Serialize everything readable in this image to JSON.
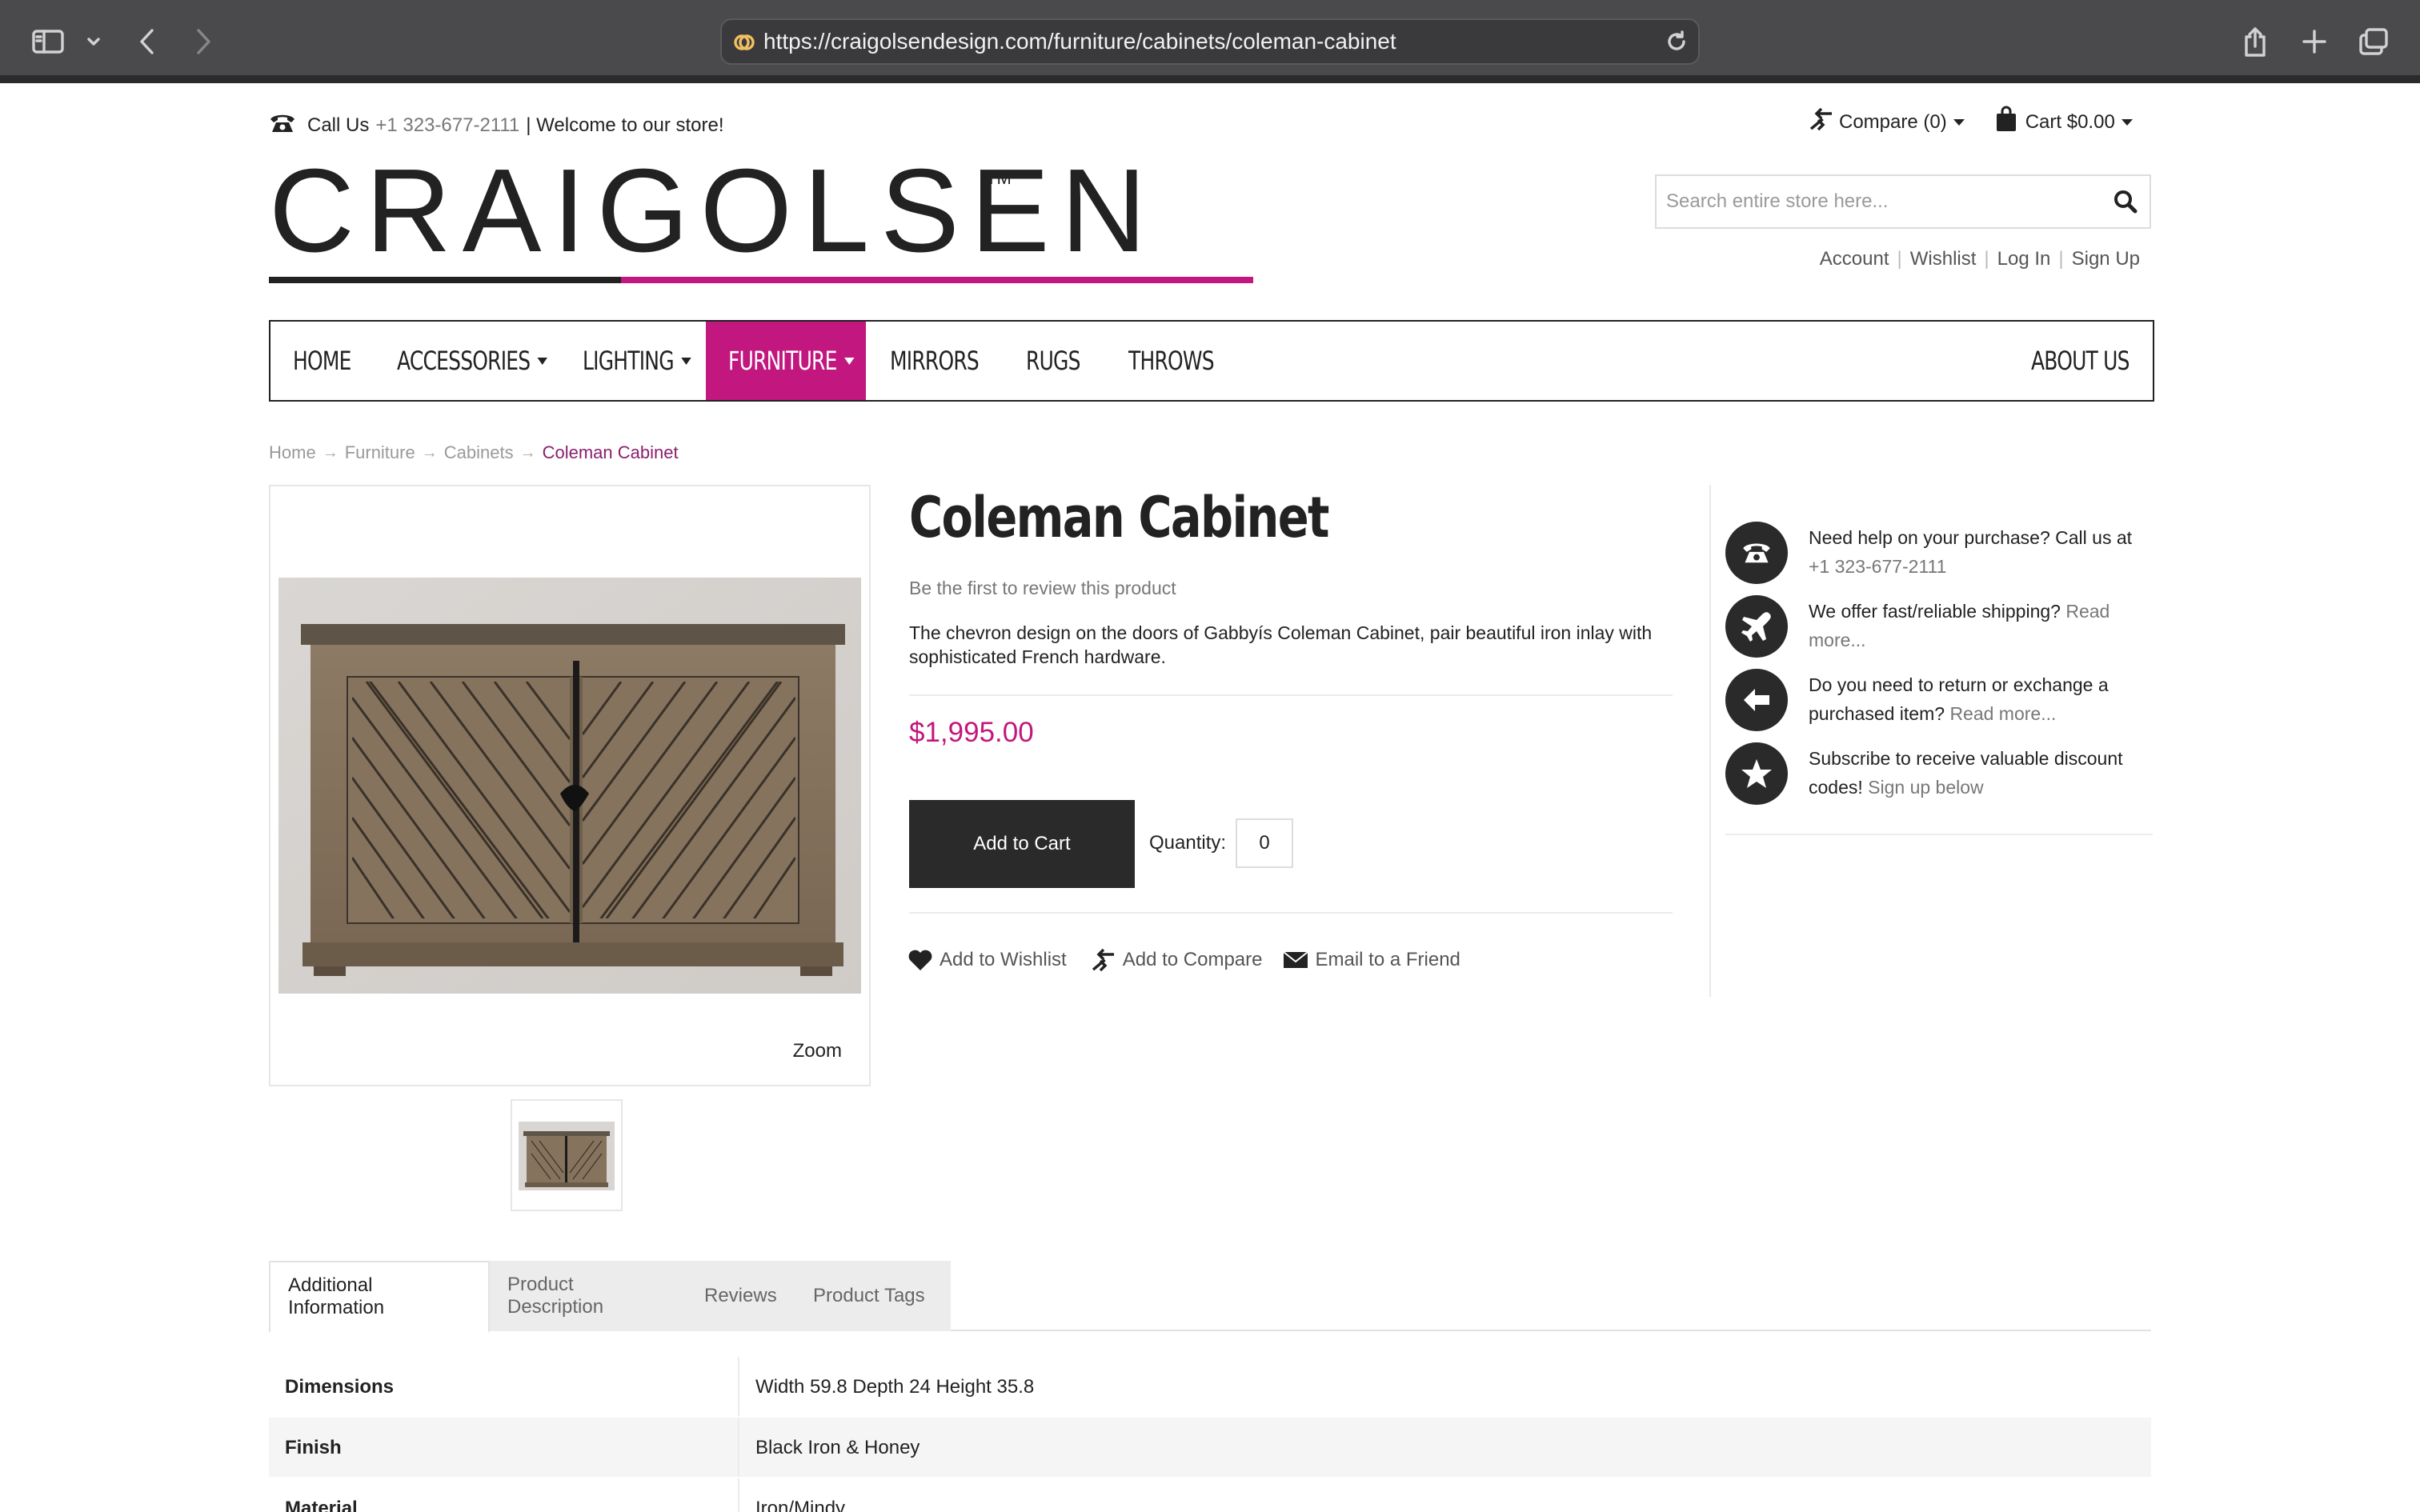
{
  "browser": {
    "url": "https://craigolsendesign.com/furniture/cabinets/coleman-cabinet"
  },
  "topbar": {
    "call_label": "Call Us",
    "phone": "+1 323-677-2111",
    "welcome": "| Welcome to our store!",
    "compare": "Compare (0)",
    "cart": "Cart $0.00"
  },
  "logo": {
    "text": "CRAIGOLSEN",
    "tm": "TM",
    "accent_color": "#c2177e"
  },
  "search": {
    "placeholder": "Search entire store here..."
  },
  "account_links": [
    "Account",
    "Wishlist",
    "Log In",
    "Sign Up"
  ],
  "nav": {
    "items": [
      "HOME",
      "ACCESSORIES",
      "LIGHTING",
      "FURNITURE",
      "MIRRORS",
      "RUGS",
      "THROWS",
      "ABOUT US"
    ],
    "active": "FURNITURE"
  },
  "breadcrumb": [
    "Home",
    "Furniture",
    "Cabinets",
    "Coleman Cabinet"
  ],
  "product": {
    "title": "Coleman Cabinet",
    "review_prompt": "Be the first to review this product",
    "description": "The chevron design on the doors of Gabbyís Coleman Cabinet, pair beautiful iron inlay with sophisticated French hardware.",
    "price": "$1,995.00",
    "add_to_cart": "Add to Cart",
    "quantity_label": "Quantity:",
    "quantity_value": "0",
    "zoom_label": "Zoom",
    "actions": [
      "Add to Wishlist",
      "Add to Compare",
      "Email to a Friend"
    ]
  },
  "help": [
    {
      "icon": "phone-icon",
      "text": "Need help on your purchase? Call us at",
      "muted": "+1 323-677-2111"
    },
    {
      "icon": "airplane-icon",
      "text": "We offer fast/reliable shipping?",
      "muted": "Read more..."
    },
    {
      "icon": "arrow-left-icon",
      "text": "Do you need to return or exchange a purchased item?",
      "muted": "Read more..."
    },
    {
      "icon": "star-icon",
      "text": "Subscribe to receive valuable discount codes!",
      "muted": "Sign up below"
    }
  ],
  "tabs": [
    "Additional Information",
    "Product Description",
    "Reviews",
    "Product Tags"
  ],
  "info_rows": [
    {
      "key": "Dimensions",
      "value": "Width 59.8 Depth 24 Height 35.8"
    },
    {
      "key": "Finish",
      "value": "Black Iron & Honey"
    },
    {
      "key": "Material",
      "value": "Iron/Mindy"
    }
  ]
}
